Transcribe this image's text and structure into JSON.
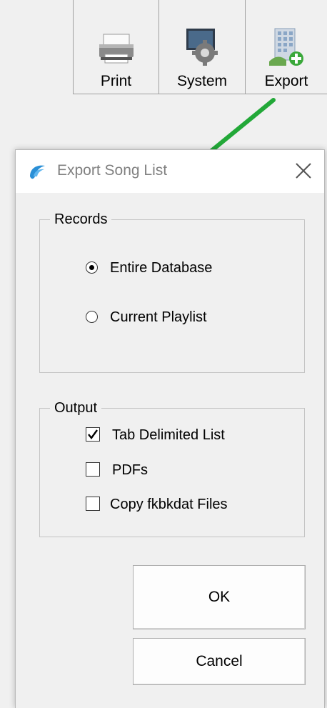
{
  "toolbar": {
    "buttons": [
      {
        "label": "Print",
        "icon": "printer-icon"
      },
      {
        "label": "System",
        "icon": "gear-icon"
      },
      {
        "label": "Export",
        "icon": "building-add-icon"
      }
    ]
  },
  "dialog": {
    "title": "Export Song List",
    "records": {
      "legend": "Records",
      "options": [
        {
          "label": "Entire Database",
          "selected": true
        },
        {
          "label": "Current Playlist",
          "selected": false
        }
      ]
    },
    "output": {
      "legend": "Output",
      "options": [
        {
          "label": "Tab Delimited List",
          "checked": true
        },
        {
          "label": "PDFs",
          "checked": false
        },
        {
          "label": "Copy fkbkdat Files",
          "checked": false
        }
      ]
    },
    "ok_label": "OK",
    "cancel_label": "Cancel"
  },
  "colors": {
    "annotation_arrow": "#22a838",
    "title_text": "#808080",
    "window_bg": "#f0f0f0"
  }
}
